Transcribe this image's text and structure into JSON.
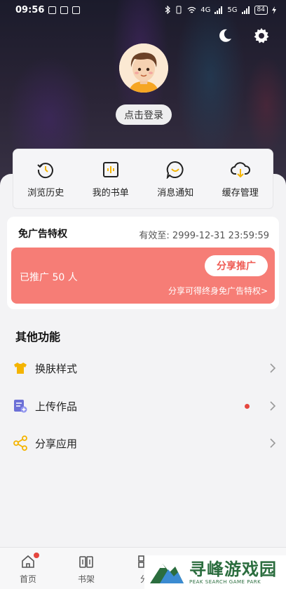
{
  "status_bar": {
    "time": "09:56",
    "battery": "84",
    "signal_a": "4G",
    "signal_b": "5G"
  },
  "header": {
    "night_icon": "moon-icon",
    "settings_icon": "gear-icon"
  },
  "profile": {
    "login_label": "点击登录"
  },
  "quick_actions": [
    {
      "label": "浏览历史",
      "icon": "history-icon"
    },
    {
      "label": "我的书单",
      "icon": "booklist-icon"
    },
    {
      "label": "消息通知",
      "icon": "message-icon"
    },
    {
      "label": "缓存管理",
      "icon": "download-cloud-icon"
    }
  ],
  "ad_free": {
    "title": "免广告特权",
    "valid_until": "有效至: 2999-12-31 23:59:59",
    "promoted": "已推广 50 人",
    "share_button": "分享推广",
    "tip": "分享可得终身免广告特权>"
  },
  "other": {
    "title": "其他功能",
    "items": [
      {
        "label": "换肤样式",
        "icon": "tshirt-icon",
        "color": "#f4b400"
      },
      {
        "label": "上传作品",
        "icon": "upload-doc-icon",
        "color": "#6b6fd6",
        "has_dot": true
      },
      {
        "label": "分享应用",
        "icon": "share-icon",
        "color": "#f4b400"
      }
    ]
  },
  "tabbar": {
    "tabs": [
      {
        "label": "首页",
        "icon": "home-icon",
        "badge": true
      },
      {
        "label": "书架",
        "icon": "bookshelf-icon"
      },
      {
        "label": "分",
        "icon": "category-icon"
      }
    ]
  },
  "watermark": {
    "cn": "寻峰游戏园",
    "en": "PEAK SEARCH GAME PARK"
  },
  "colors": {
    "accent": "#f67d76",
    "share_text": "#ef5b53",
    "badge": "#e5463e"
  }
}
